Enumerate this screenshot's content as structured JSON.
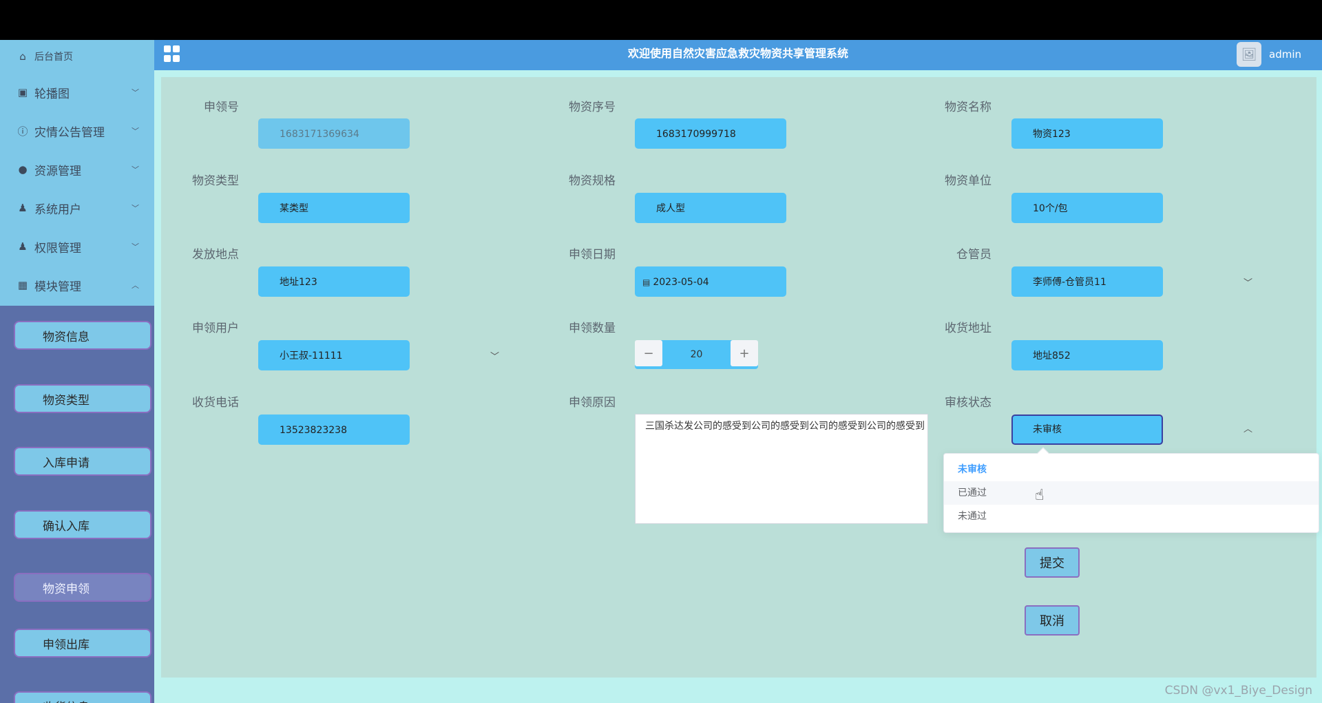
{
  "app": {
    "title": "欢迎使用自然灾害应急救灾物资共享管理系统",
    "user": "admin"
  },
  "sidebar": {
    "home": "后台首页",
    "items": [
      {
        "label": "轮播图",
        "icon": "picture-icon"
      },
      {
        "label": "灾情公告管理",
        "icon": "info-circle-icon"
      },
      {
        "label": "资源管理",
        "icon": "location-icon"
      },
      {
        "label": "系统用户",
        "icon": "user-icon"
      },
      {
        "label": "权限管理",
        "icon": "user-icon"
      },
      {
        "label": "模块管理",
        "icon": "grid-icon"
      }
    ],
    "submenu": [
      {
        "label": "物资信息"
      },
      {
        "label": "物资类型"
      },
      {
        "label": "入库申请"
      },
      {
        "label": "确认入库"
      },
      {
        "label": "物资申领",
        "active": true
      },
      {
        "label": "申领出库"
      },
      {
        "label": "收货信息"
      }
    ]
  },
  "form": {
    "apply_no": {
      "label": "申领号",
      "value": "1683171369634"
    },
    "item_serial": {
      "label": "物资序号",
      "value": "1683170999718"
    },
    "item_name": {
      "label": "物资名称",
      "value": "物资123"
    },
    "item_type": {
      "label": "物资类型",
      "value": "某类型"
    },
    "item_spec": {
      "label": "物资规格",
      "value": "成人型"
    },
    "item_unit": {
      "label": "物资单位",
      "value": "10个/包"
    },
    "issue_place": {
      "label": "发放地点",
      "value": "地址123"
    },
    "apply_date": {
      "label": "申领日期",
      "value": "2023-05-04"
    },
    "keeper": {
      "label": "仓管员",
      "value": "李师傅-仓管员11"
    },
    "apply_user": {
      "label": "申领用户",
      "value": "小王叔-11111"
    },
    "quantity": {
      "label": "申领数量",
      "value": "20"
    },
    "ship_address": {
      "label": "收货地址",
      "value": "地址852"
    },
    "ship_phone": {
      "label": "收货电话",
      "value": "13523823238"
    },
    "reason": {
      "label": "申领原因",
      "value": "三国杀达发公司的感受到公司的感受到公司的感受到公司的感受到"
    },
    "audit_status": {
      "label": "审核状态",
      "value": "未审核",
      "options": [
        "未审核",
        "已通过",
        "未通过"
      ]
    },
    "submit_label": "提交",
    "cancel_label": "取消"
  },
  "watermark": "CSDN @vx1_Biye_Design",
  "colors": {
    "header": "#4a9be0",
    "field": "#4fc3f7",
    "form_bg": "#bbdfd8",
    "sidebar": "#5b6fa8"
  }
}
